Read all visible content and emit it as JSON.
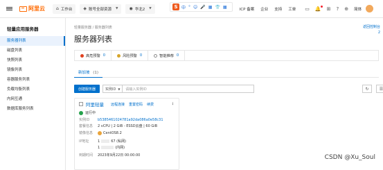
{
  "topbar": {
    "logo_text": "阿里云",
    "workbench": "工作台",
    "account_scope": "账号全部资源",
    "region": "华北2",
    "nav": [
      "费用",
      "ICP 备案",
      "企业",
      "支持",
      "工单"
    ],
    "lang": "简体"
  },
  "ime": {
    "logo": "S",
    "items": [
      "中",
      "°",
      "☺",
      "🎤",
      "▦",
      "👕",
      "▦"
    ]
  },
  "sidebar": {
    "title": "轻量应用服务器",
    "items": [
      "服务器列表",
      "磁盘列表",
      "快照列表",
      "镜像列表",
      "容器服务列表",
      "负载均衡列表",
      "内网互通",
      "数据库服务列表"
    ]
  },
  "main": {
    "breadcrumb": "轻量服务器 / 服务器列表",
    "title": "服务器列表",
    "right_link_1": "返回控制台",
    "right_link_2": "2"
  },
  "alerts": [
    {
      "label": "高危预警",
      "count": "0",
      "color": "#e0411f"
    },
    {
      "label": "风险预警",
      "count": "0",
      "color": "#d6a52a"
    },
    {
      "label": "智能推荐",
      "count": "0",
      "color": "#8c8c8c"
    }
  ],
  "tab": {
    "label": "新加坡",
    "count": "(1)"
  },
  "toolbar": {
    "create_label": "创建服务器",
    "filter_label": "实例ID",
    "search_placeholder": "请输入实例ID"
  },
  "instance": {
    "name": "阿里轻量",
    "actions": [
      "远程连接",
      "重置密码",
      "续费"
    ],
    "more": "⋮",
    "status": "运行中",
    "rows": {
      "id_label": "实例ID",
      "id_value": "b5385461024781a92da086a0e58c31",
      "spec_label": "套餐信息",
      "spec_value": "2 vCPU | 2 GiB - ESSD云盘 | 60 GiB",
      "image_label": "镜像信息",
      "image_value": "CentOS8.2",
      "ip_label": "IP地址",
      "ip_public_prefix": "1",
      "ip_public_suffix": "67 (私网)",
      "ip_private_prefix": "1",
      "ip_private_suffix": "(内网)",
      "expire_label": "到期时间",
      "expire_value": "2023年9月22日 00:00:00"
    }
  },
  "watermark": "CSDN @Xu_Soul"
}
